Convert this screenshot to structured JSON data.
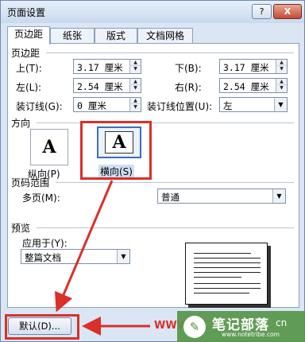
{
  "window": {
    "title": "页面设置",
    "help_button": "?",
    "close_button": "X"
  },
  "tabs": [
    "页边距",
    "纸张",
    "版式",
    "文档网格"
  ],
  "margins": {
    "section_label": "页边距",
    "top_label": "上(T):",
    "top_value": "3.17 厘米",
    "bottom_label": "下(B):",
    "bottom_value": "3.17 厘米",
    "left_label": "左(L):",
    "left_value": "2.54 厘米",
    "right_label": "右(R):",
    "right_value": "2.54 厘米",
    "gutter_label": "装订线(G):",
    "gutter_value": "0 厘米",
    "gutter_pos_label": "装订线位置(U):",
    "gutter_pos_value": "左"
  },
  "orientation": {
    "section_label": "方向",
    "glyph": "A",
    "portrait_label": "纵向(P)",
    "landscape_label": "横向(S)",
    "selected": "landscape"
  },
  "pages": {
    "section_label": "页码范围",
    "multiple_label": "多页(M):",
    "multiple_value": "普通"
  },
  "preview": {
    "section_label": "预览",
    "apply_label": "应用于(Y):",
    "apply_value": "整篇文档"
  },
  "footer": {
    "default_button": "默认(D)..."
  },
  "watermark": {
    "logo": "✎",
    "title": "笔记部落",
    "domain_suffix": "cn",
    "url": "www.notetribe.com",
    "www": "WWW"
  },
  "colors": {
    "highlight": "#d9302a",
    "watermark": "#569648",
    "window_bg": "#dbe6f4"
  },
  "icons": {
    "up": "▲",
    "down": "▼",
    "dropdown": "▼"
  }
}
